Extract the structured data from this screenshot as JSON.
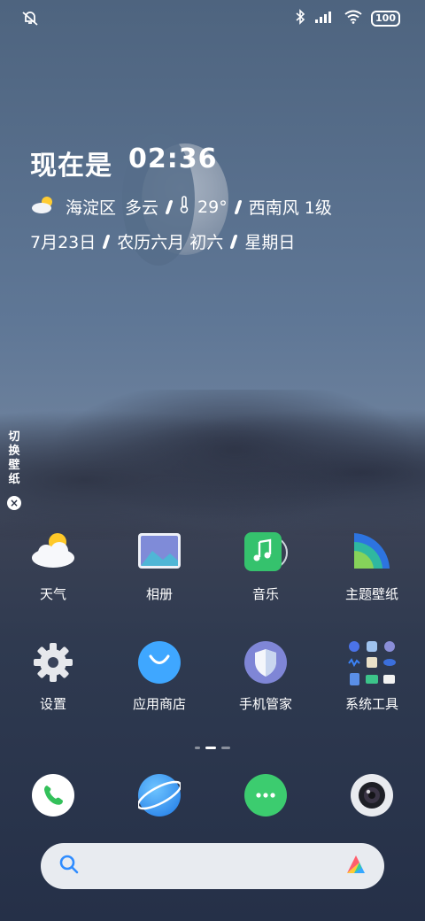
{
  "status_bar": {
    "left_icon": "alarm-off-icon",
    "right_icons": [
      "bluetooth-icon",
      "signal-icon",
      "wifi-icon"
    ],
    "battery": "100"
  },
  "widget": {
    "now_label": "现在是",
    "time": "02:36",
    "district": "海淀区",
    "condition": "多云",
    "temperature": "29°",
    "wind": "西南风 1级",
    "date": "7月23日",
    "lunar": "农历六月 初六",
    "weekday": "星期日"
  },
  "side_panel": {
    "label_chars": [
      "切",
      "换",
      "壁",
      "纸"
    ],
    "close": "×"
  },
  "apps_row1": [
    {
      "label": "天气",
      "icon": "weather-icon"
    },
    {
      "label": "相册",
      "icon": "gallery-icon"
    },
    {
      "label": "音乐",
      "icon": "music-icon"
    },
    {
      "label": "主题壁纸",
      "icon": "themes-icon"
    }
  ],
  "apps_row2": [
    {
      "label": "设置",
      "icon": "settings-icon"
    },
    {
      "label": "应用商店",
      "icon": "app-store-icon"
    },
    {
      "label": "手机管家",
      "icon": "security-icon"
    },
    {
      "label": "系统工具",
      "icon": "tools-folder-icon"
    }
  ],
  "page_indicator": {
    "pages": 3,
    "current": 2
  },
  "dock": [
    {
      "icon": "phone-icon"
    },
    {
      "icon": "browser-icon"
    },
    {
      "icon": "messages-icon"
    },
    {
      "icon": "camera-icon"
    }
  ],
  "search_bar": {
    "icon": "search-icon",
    "assistant_icon": "assistant-icon"
  },
  "colors": {
    "accent": "#4fa3ff",
    "phone_green": "#34c759",
    "message_green": "#3ccc6f"
  }
}
